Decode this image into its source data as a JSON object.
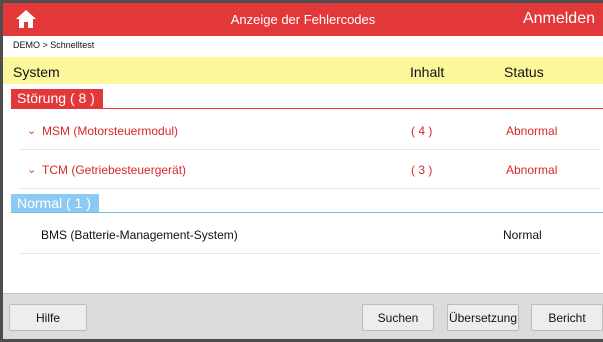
{
  "titlebar": {
    "title": "Anzeige der Fehlercodes",
    "login_label": "Anmelden",
    "home_icon": "home-icon",
    "accent": "#e2383a"
  },
  "breadcrumb": "DEMO > Schnelltest",
  "table": {
    "headers": {
      "system": "System",
      "inhalt": "Inhalt",
      "status": "Status"
    },
    "header_bg": "#fbf79a"
  },
  "groups": {
    "error": {
      "label": "Störung",
      "count": "( 8 )",
      "rows": [
        {
          "name": "MSM (Motorsteuermodul)",
          "count": "( 4 )",
          "status": "Abnormal"
        },
        {
          "name": "TCM (Getriebesteuergerät)",
          "count": "( 3 )",
          "status": "Abnormal"
        }
      ]
    },
    "normal": {
      "label": "Normal",
      "count": "( 1 )",
      "rows": [
        {
          "name": "BMS (Batterie-Management-System)",
          "status": "Normal"
        }
      ]
    }
  },
  "buttons": {
    "hilfe": "Hilfe",
    "suchen": "Suchen",
    "uebersetzung": "Übersetzung",
    "bericht": "Bericht"
  }
}
